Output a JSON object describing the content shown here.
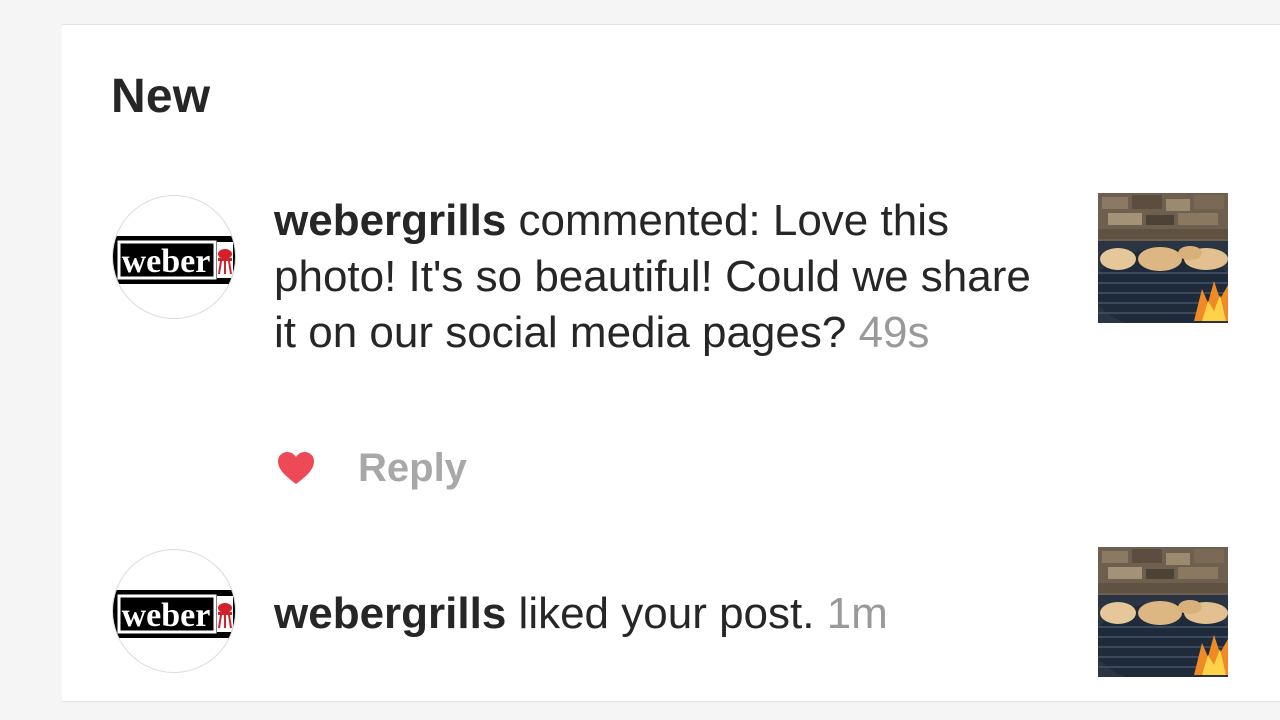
{
  "section": {
    "title": "New"
  },
  "notifications": [
    {
      "username": "webergrills",
      "message": " commented: Love this photo! It's so beautiful! Could we share it on our social media pages? ",
      "time": "49s",
      "reply_label": "Reply",
      "avatar_icon": "weber-logo-icon",
      "thumbnail_icon": "grill-photo-thumbnail"
    },
    {
      "username": "webergrills",
      "message": " liked your post. ",
      "time": "1m",
      "avatar_icon": "weber-logo-icon",
      "thumbnail_icon": "grill-photo-thumbnail"
    }
  ],
  "avatar": {
    "logo_text": "weber"
  },
  "colors": {
    "heart": "#ed4956",
    "secondary_text": "#999999",
    "reply": "#a8a8a8",
    "logo_red": "#d3202b"
  }
}
